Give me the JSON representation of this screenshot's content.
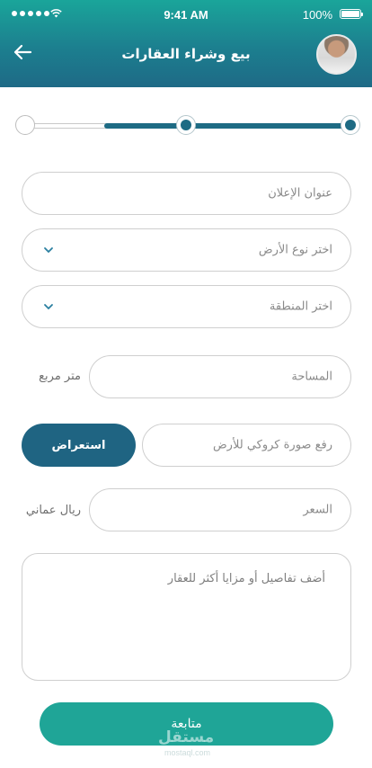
{
  "status_bar": {
    "time": "9:41 AM",
    "battery": "100%"
  },
  "header": {
    "title": "بيع وشراء العقارات"
  },
  "stepper": {
    "total_steps": 3,
    "completed_steps": 2
  },
  "form": {
    "ad_title_placeholder": "عنوان الإعلان",
    "land_type_placeholder": "اختر نوع الأرض",
    "region_placeholder": "اختر  المنطقة",
    "area_placeholder": "المساحة",
    "area_unit": "متر مربع",
    "sketch_placeholder": "رفع صورة كروكي للأرض",
    "browse_label": "استعراض",
    "price_placeholder": "السعر",
    "price_unit": "ريال عماني",
    "details_placeholder": "أضف تفاصيل أو مزايا أكثر للعقار",
    "continue_label": "متابعة"
  },
  "watermark": {
    "text": "مستقل",
    "sub": "mostaql.com"
  },
  "colors": {
    "header_gradient_top": "#1aa59a",
    "header_gradient_bottom": "#1e6a86",
    "primary_dark": "#1f6482",
    "primary_green": "#1fa597"
  }
}
